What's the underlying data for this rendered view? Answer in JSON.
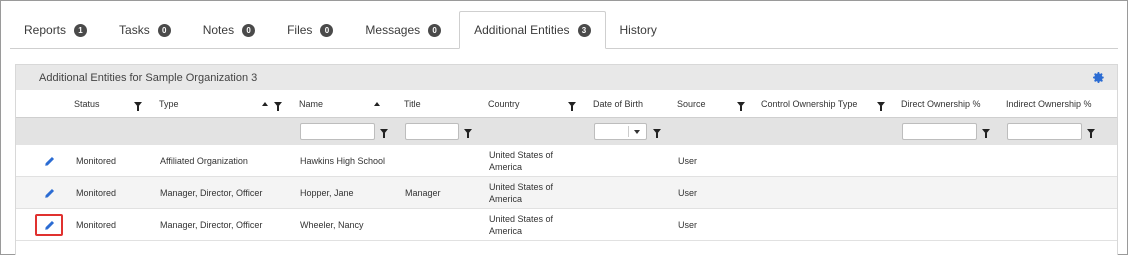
{
  "tabs": [
    {
      "label": "Reports",
      "count": "1"
    },
    {
      "label": "Tasks",
      "count": "0"
    },
    {
      "label": "Notes",
      "count": "0"
    },
    {
      "label": "Files",
      "count": "0"
    },
    {
      "label": "Messages",
      "count": "0"
    },
    {
      "label": "Additional Entities",
      "count": "3",
      "active": true
    },
    {
      "label": "History",
      "count": ""
    }
  ],
  "panel": {
    "title": "Additional Entities for Sample Organization 3",
    "settings_icon": "gear-icon"
  },
  "columns": {
    "status": "Status",
    "type": "Type",
    "name": "Name",
    "title": "Title",
    "country": "Country",
    "dob": "Date of Birth",
    "source": "Source",
    "control_type": "Control Ownership Type",
    "direct_pct": "Direct Ownership %",
    "indirect_pct": "Indirect Ownership %"
  },
  "rows": [
    {
      "status": "Monitored",
      "type": "Affiliated Organization",
      "name": "Hawkins High School",
      "title": "",
      "country_1": "United States of",
      "country_2": "America",
      "dob": "",
      "source": "User"
    },
    {
      "status": "Monitored",
      "type": "Manager, Director, Officer",
      "name": "Hopper, Jane",
      "title": "Manager",
      "country_1": "United States of",
      "country_2": "America",
      "dob": "",
      "source": "User"
    },
    {
      "status": "Monitored",
      "type": "Manager, Director, Officer",
      "name": "Wheeler, Nancy",
      "title": "",
      "country_1": "United States of",
      "country_2": "America",
      "dob": "",
      "source": "User",
      "highlighted": true
    }
  ],
  "colors": {
    "accent": "#2b6cd3",
    "highlight": "#e0312f",
    "header_bg": "#e8e8e8"
  }
}
